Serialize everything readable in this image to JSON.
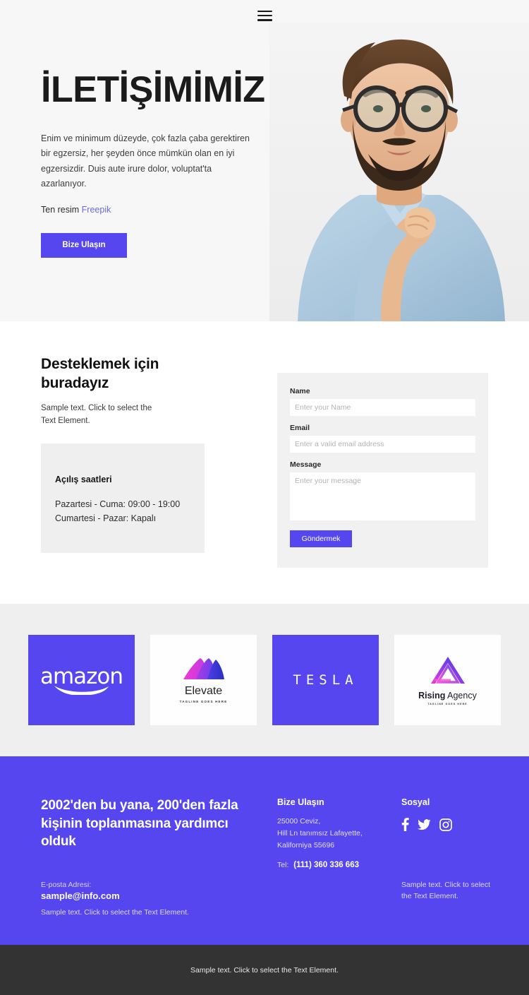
{
  "nav": {
    "menu_icon": "hamburger-menu-icon"
  },
  "hero": {
    "title": "İLETİŞİMİMİZ",
    "paragraph": "Enim ve minimum düzeyde, çok fazla çaba gerektiren bir egzersiz, her şeyden önce mümkün olan en iyi egzersizdir. Duis aute irure dolor, voluptat'ta azarlanıyor.",
    "credit_prefix": "Ten resim",
    "credit_link": "Freepik",
    "cta_label": "Bize Ulaşın",
    "image_alt": "portrait-of-thoughtful-bearded-man-with-glasses"
  },
  "contact": {
    "title": "Desteklemek için buradayız",
    "subtitle": "Sample text. Click to select the Text Element.",
    "hours_title": "Açılış saatleri",
    "hours_weekday": "Pazartesi - Cuma: 09:00 - 19:00",
    "hours_weekend": "Cumartesi - Pazar: Kapalı"
  },
  "form": {
    "name_label": "Name",
    "name_placeholder": "Enter your Name",
    "email_label": "Email",
    "email_placeholder": "Enter a valid email address",
    "message_label": "Message",
    "message_placeholder": "Enter your message",
    "submit_label": "Göndermek"
  },
  "logos": [
    {
      "name": "amazon",
      "word": "amazon",
      "style": "purple"
    },
    {
      "name": "Elevate",
      "word": "Elevate",
      "tagline": "TAGLINE GOES HERE",
      "style": "white"
    },
    {
      "name": "TESLA",
      "word": "TESLA",
      "style": "purple"
    },
    {
      "name": "Rising Agency",
      "word_bold": "Rising",
      "word_light": "Agency",
      "tagline": "TAGLINE GOES HERE",
      "style": "white"
    }
  ],
  "footer": {
    "headline": "2002'den bu yana, 200'den fazla kişinin toplanmasına yardımcı olduk",
    "email_label": "E-posta Adresi:",
    "email": "sample@info.com",
    "note_left": "Sample text. Click to select the Text Element.",
    "col2_title": "Bize Ulaşın",
    "address_line1": "25000 Ceviz,",
    "address_line2": "Hill Ln tanımsız Lafayette,",
    "address_line3": "Kaliforniya 55696",
    "tel_label": "Tel:",
    "tel_number": "(111) 360 336 663",
    "col3_title": "Sosyal",
    "social": [
      "facebook-icon",
      "twitter-icon",
      "instagram-icon"
    ],
    "note_right": "Sample text. Click to select the Text Element."
  },
  "bottombar": {
    "text": "Sample text. Click to select the Text Element."
  },
  "colors": {
    "accent": "#5546f0",
    "hero_bg": "#f7f7f7",
    "light_gray": "#efefef",
    "dark_bar": "#333333",
    "link": "#6b6bd8"
  }
}
